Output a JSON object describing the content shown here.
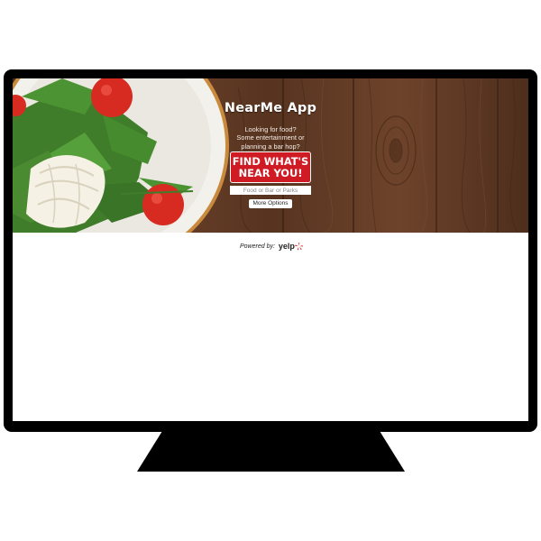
{
  "app": {
    "title": "NearMe App",
    "tagline": "Looking for food?\nSome entertainment or\nplanning a bar hop?",
    "find_button": "FIND WHAT'S\nNEAR YOU!",
    "search_placeholder": "Food or Bar or Parks",
    "more_options": "More Options"
  },
  "footer": {
    "powered_by": "Powered by:",
    "brand": "yelp"
  },
  "colors": {
    "accent": "#cf1b23",
    "wood": "#5a3521",
    "yelp": "#d32323",
    "bezel": "#000000"
  },
  "icons": {
    "hero_image": "salad-plate-image",
    "brand_logo": "yelp-burst-icon"
  }
}
